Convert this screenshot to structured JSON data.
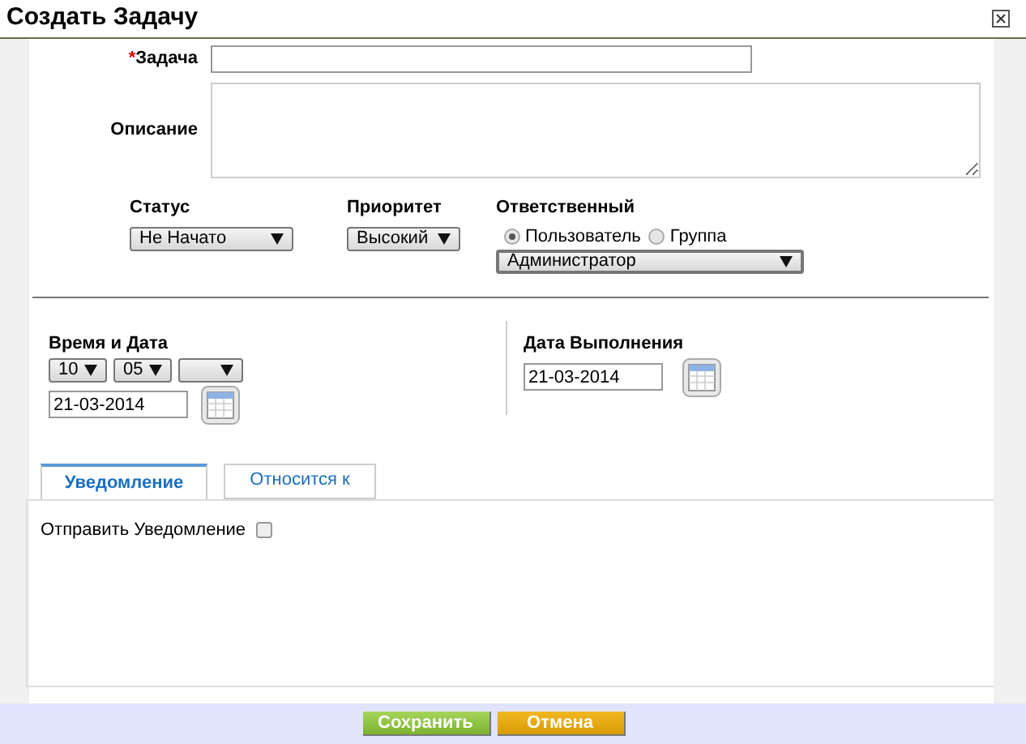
{
  "window": {
    "title": "Создать Задачу"
  },
  "task": {
    "required_mark": "*",
    "label": "Задача"
  },
  "description": {
    "label": "Описание"
  },
  "status": {
    "label": "Статус",
    "value": "Не Начато"
  },
  "priority": {
    "label": "Приоритет",
    "value": "Высокий"
  },
  "assignee": {
    "label": "Ответственный",
    "options": [
      {
        "label": "Пользователь",
        "selected": true
      },
      {
        "label": "Группа",
        "selected": false
      }
    ],
    "value": "Администратор"
  },
  "start": {
    "label": "Время и Дата",
    "hour": "10",
    "minute": "05",
    "date": "21-03-2014"
  },
  "due": {
    "label": "Дата Выполнения",
    "date": "21-03-2014"
  },
  "tabs": [
    {
      "label": "Уведомление",
      "selected": true
    },
    {
      "label": "Относится к",
      "selected": false
    }
  ],
  "notify": {
    "label": "Отправить Уведомление",
    "checked": false
  },
  "buttons": [
    {
      "label": "Сохранить",
      "kind": "primary"
    },
    {
      "label": "Отмена",
      "kind": "cancel"
    }
  ]
}
